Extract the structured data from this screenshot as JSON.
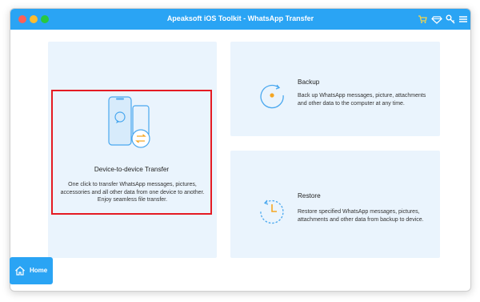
{
  "window": {
    "title": "Apeaksoft iOS Toolkit - WhatsApp Transfer"
  },
  "toolbar": {
    "icons": [
      "cart-icon",
      "diamond-icon",
      "key-icon",
      "menu-icon"
    ]
  },
  "features": {
    "device_transfer": {
      "title": "Device-to-device Transfer",
      "description": "One click to transfer WhatsApp messages, pictures, accessories and all other data from one device to another. Enjoy seamless file transfer."
    },
    "backup": {
      "title": "Backup",
      "description": "Back up WhatsApp messages, picture, attachments and other data to the computer at any time."
    },
    "restore": {
      "title": "Restore",
      "description": "Restore specified WhatsApp messages, pictures, attachments and other data from backup to device."
    }
  },
  "sidebar": {
    "home_label": "Home"
  },
  "colors": {
    "accent": "#2aa4f4",
    "card_background": "#eaf4fd",
    "highlight_border": "#e51b23",
    "backup_dot": "#f5a623"
  }
}
